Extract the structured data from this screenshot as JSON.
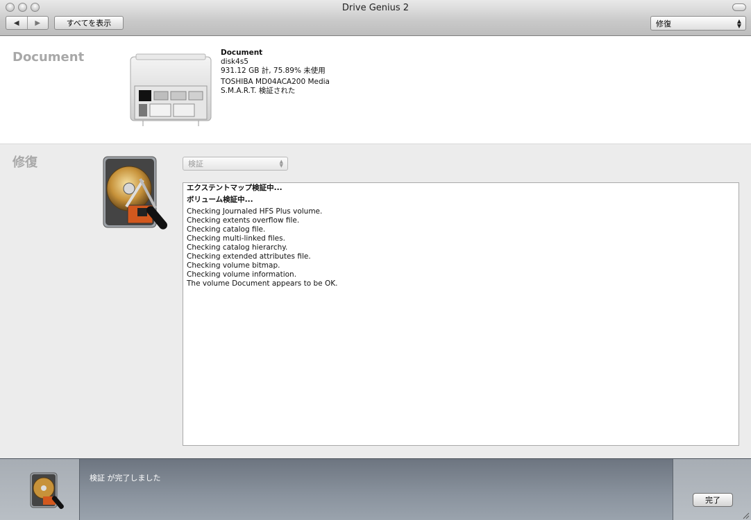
{
  "window": {
    "title": "Drive Genius 2"
  },
  "toolbar": {
    "back_icon": "◀",
    "forward_icon": "▶",
    "show_all_label": "すべてを表示",
    "mode_value": "修復"
  },
  "disk": {
    "section_title": "Document",
    "name": "Document",
    "device": "disk4s5",
    "capacity": "931.12 GB 計, 75.89% 未使用",
    "model": "TOSHIBA MD04ACA200 Media",
    "smart": "S.M.A.R.T. 検証された"
  },
  "repair": {
    "section_title": "修復",
    "operation_value": "検証",
    "log_headers": [
      "エクステントマップ検証中...",
      "ボリューム検証中..."
    ],
    "log_lines": [
      "Checking Journaled HFS Plus volume.",
      "Checking extents overflow file.",
      "Checking catalog file.",
      "Checking multi-linked files.",
      "Checking catalog hierarchy.",
      "Checking extended attributes file.",
      "Checking volume bitmap.",
      "Checking volume information.",
      "The volume Document appears to be OK."
    ]
  },
  "status": {
    "message": "検証 が完了しました",
    "done_label": "完了"
  },
  "icons": {
    "disk_image": "mac-pro-icon",
    "repair_image": "hard-drive-screwdriver-icon",
    "status_image": "hard-drive-screwdriver-icon"
  }
}
